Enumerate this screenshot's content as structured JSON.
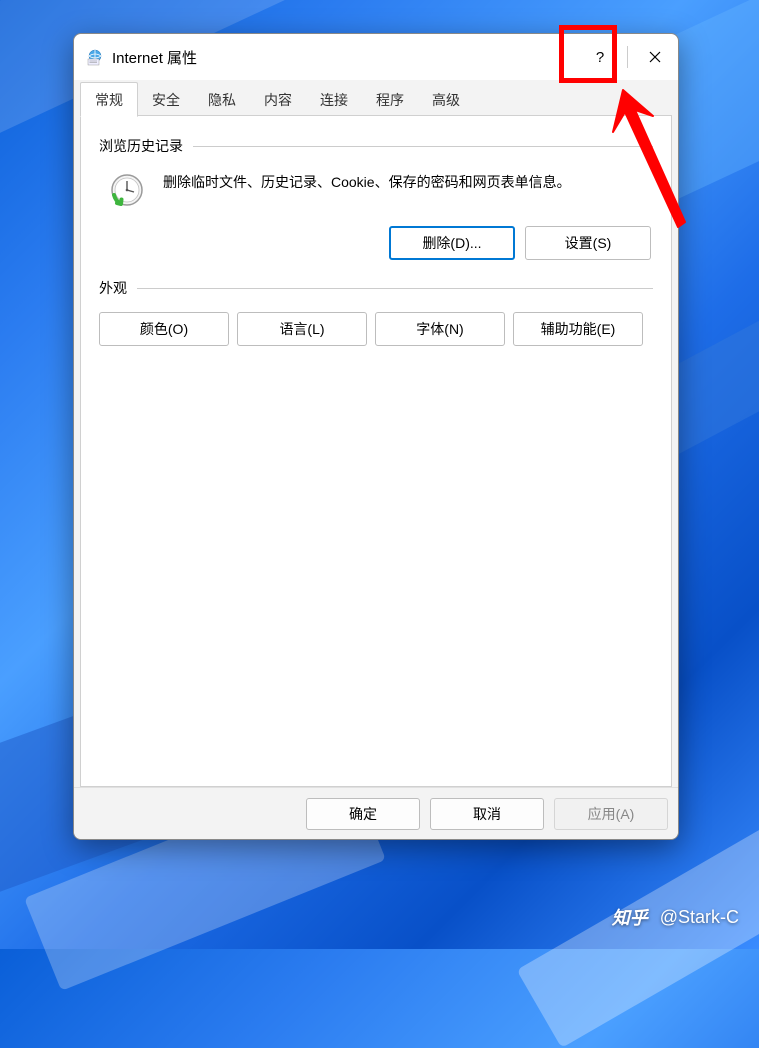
{
  "window": {
    "title": "Internet 属性",
    "help_label": "?",
    "close_label": "✕"
  },
  "tabs": {
    "items": [
      {
        "label": "常规",
        "active": true
      },
      {
        "label": "安全",
        "active": false
      },
      {
        "label": "隐私",
        "active": false
      },
      {
        "label": "内容",
        "active": false
      },
      {
        "label": "连接",
        "active": false
      },
      {
        "label": "程序",
        "active": false
      },
      {
        "label": "高级",
        "active": false
      }
    ]
  },
  "history": {
    "group_label": "浏览历史记录",
    "description": "删除临时文件、历史记录、Cookie、保存的密码和网页表单信息。",
    "delete_button": "删除(D)...",
    "settings_button": "设置(S)"
  },
  "appearance": {
    "group_label": "外观",
    "colors_button": "颜色(O)",
    "languages_button": "语言(L)",
    "fonts_button": "字体(N)",
    "accessibility_button": "辅助功能(E)"
  },
  "footer": {
    "ok": "确定",
    "cancel": "取消",
    "apply": "应用(A)"
  },
  "watermark": {
    "platform": "知乎",
    "author": "@Stark-C"
  },
  "annotation": {
    "target": "help-button",
    "highlight_color": "#ff0000"
  }
}
